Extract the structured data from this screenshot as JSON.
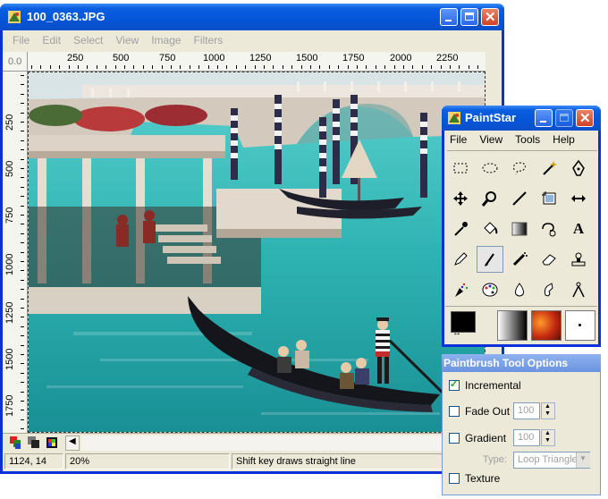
{
  "main_window": {
    "title": "100_0363.JPG",
    "menu": [
      "File",
      "Edit",
      "Select",
      "View",
      "Image",
      "Filters"
    ],
    "ruler_corner": "0.0",
    "ruler_h_labels": [
      "250",
      "500",
      "750",
      "1000",
      "1250",
      "1500",
      "1750",
      "2000",
      "2250"
    ],
    "ruler_v_labels": [
      "250",
      "500",
      "750",
      "1000",
      "1250",
      "1500",
      "1750"
    ],
    "status": {
      "coords": "1124, 14",
      "zoom": "20%",
      "hint": "Shift key draws straight line"
    }
  },
  "paintstar": {
    "title": "PaintStar",
    "menu": [
      "File",
      "View",
      "Tools",
      "Help"
    ],
    "tools": [
      "rect-select-icon",
      "ellipse-select-icon",
      "lasso-icon",
      "magic-wand-icon",
      "bezier-pen-icon",
      "move-icon",
      "zoom-icon",
      "line-icon",
      "crop-icon",
      "resize-arrows-icon",
      "eyedropper-icon",
      "fill-bucket-icon",
      "gradient-icon",
      "clone-stamp-icon",
      "text-icon",
      "pencil-icon",
      "paintbrush-icon",
      "airbrush-icon",
      "eraser-icon",
      "stamp-icon",
      "spray-icon",
      "palette-icon",
      "drop-icon",
      "smudge-icon",
      "compass-icon"
    ]
  },
  "tool_options": {
    "title": "Paintbrush Tool Options",
    "incremental_label": "Incremental",
    "fade_out_label": "Fade Out",
    "fade_out_value": "100",
    "gradient_label": "Gradient",
    "gradient_value": "100",
    "type_label": "Type:",
    "type_value": "Loop Triangle",
    "texture_label": "Texture"
  },
  "colors": {
    "title_bar": "#0a5fe0",
    "window_frame": "#0831d9",
    "face": "#ece9d8",
    "foreground": "#000000",
    "background": "#ffffff"
  }
}
